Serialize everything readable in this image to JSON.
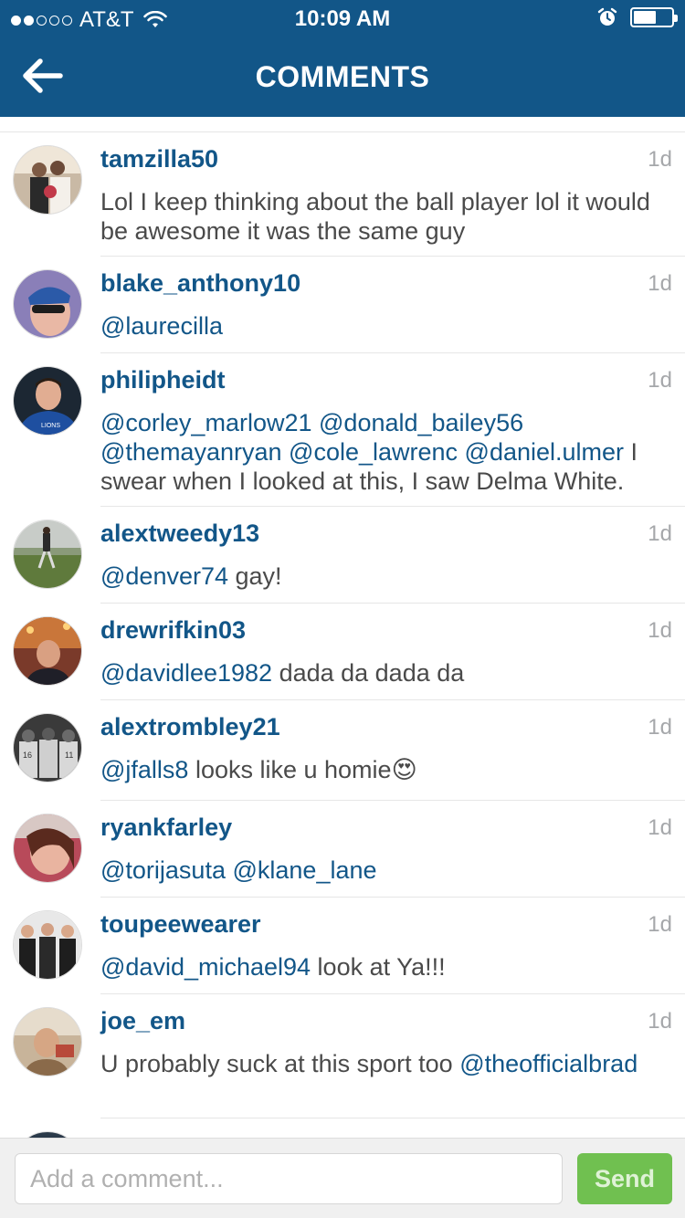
{
  "status_bar": {
    "carrier": "AT&T",
    "time": "10:09 AM",
    "signal_bars_filled": 2,
    "signal_bars_total": 5,
    "battery_level": 0.6
  },
  "header": {
    "title": "COMMENTS",
    "back_icon": "arrow-left-icon",
    "background_color": "#125688"
  },
  "comments": [
    {
      "username": "tamzilla50",
      "time": "1d",
      "text_parts": [
        {
          "text": "Lol I keep thinking about the ball player lol it would be awesome it was the same guy",
          "mention": false
        }
      ]
    },
    {
      "username": "blake_anthony10",
      "time": "1d",
      "text_parts": [
        {
          "text": "@laurecilla",
          "mention": true
        }
      ]
    },
    {
      "username": "philipheidt",
      "time": "1d",
      "text_parts": [
        {
          "text": "@corley_marlow21",
          "mention": true
        },
        {
          "text": " ",
          "mention": false
        },
        {
          "text": "@donald_bailey56",
          "mention": true
        },
        {
          "text": " ",
          "mention": false
        },
        {
          "text": "@themayanryan",
          "mention": true
        },
        {
          "text": " ",
          "mention": false
        },
        {
          "text": "@cole_lawrenc",
          "mention": true
        },
        {
          "text": " ",
          "mention": false
        },
        {
          "text": "@daniel.ulmer",
          "mention": true
        },
        {
          "text": " I swear when I looked at this, I saw Delma White.",
          "mention": false
        }
      ]
    },
    {
      "username": "alextweedy13",
      "time": "1d",
      "text_parts": [
        {
          "text": "@denver74",
          "mention": true
        },
        {
          "text": " gay!",
          "mention": false
        }
      ]
    },
    {
      "username": "drewrifkin03",
      "time": "1d",
      "text_parts": [
        {
          "text": "@davidlee1982",
          "mention": true
        },
        {
          "text": " dada da dada da",
          "mention": false
        }
      ]
    },
    {
      "username": "alextrombley21",
      "time": "1d",
      "text_parts": [
        {
          "text": "@jfalls8",
          "mention": true
        },
        {
          "text": " looks like u homie",
          "mention": false
        },
        {
          "text": "😍",
          "mention": false
        }
      ]
    },
    {
      "username": "ryankfarley",
      "time": "1d",
      "text_parts": [
        {
          "text": "@torijasuta",
          "mention": true
        },
        {
          "text": " ",
          "mention": false
        },
        {
          "text": "@klane_lane",
          "mention": true
        }
      ]
    },
    {
      "username": "toupeewearer",
      "time": "1d",
      "text_parts": [
        {
          "text": "@david_michael94",
          "mention": true
        },
        {
          "text": " look at Ya!!!",
          "mention": false
        }
      ]
    },
    {
      "username": "joe_em",
      "time": "1d",
      "text_parts": [
        {
          "text": "U probably suck at this sport too ",
          "mention": false
        },
        {
          "text": "@theofficialbrad",
          "mention": true
        }
      ]
    }
  ],
  "composer": {
    "placeholder": "Add a comment...",
    "value": "",
    "send_label": "Send",
    "send_color": "#70c050"
  }
}
